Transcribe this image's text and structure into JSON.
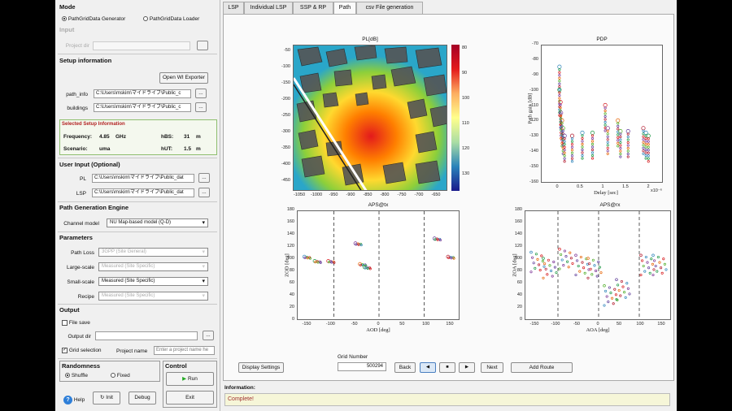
{
  "left": {
    "mode_title": "Mode",
    "mode_opt1": "PathGridData Generator",
    "mode_opt2": "PathGridData Loader",
    "input_title": "Input",
    "project_dir_label": "Project dir",
    "setup_title": "Setup information",
    "open_wi_btn": "Open WI Exporter",
    "path_info_label": "path_info",
    "path_info_value": "C:\\Users\\mskim\\マイドライブ\\Public_c",
    "buildings_label": "buildings",
    "buildings_value": "C:\\Users\\mskim\\マイドライブ\\Public_c",
    "browse": "...",
    "selected_title": "Selected Setup Information",
    "freq_label": "Frequency:",
    "freq_value": "4.85",
    "freq_unit": "GHz",
    "hbs_label": "hBS:",
    "hbs_value": "31",
    "hbs_unit": "m",
    "scenario_label": "Scenario:",
    "scenario_value": "uma",
    "hut_label": "hUT:",
    "hut_value": "1.5",
    "hut_unit": "m",
    "user_input_title": "User Input  (Optional)",
    "pl_label": "PL",
    "pl_value": "C:\\Users\\mskim\\マイドライブ\\Public_dat",
    "lsp_label": "LSP",
    "lsp_value": "C:\\Users\\mskim\\マイドライブ\\Public_dat",
    "pge_title": "Path Generation Engine",
    "channel_model_label": "Channel model",
    "channel_model_value": "NU Map-based model (Q-D)",
    "params_title": "Parameters",
    "path_loss_label": "Path Loss",
    "path_loss_value": "3GPP (Site General)",
    "large_scale_label": "Large-scale",
    "large_scale_value": "Measured (Site Specific)",
    "small_scale_label": "Small-scale",
    "small_scale_value": "Measured (Site Specific)",
    "recipe_label": "Recipe",
    "recipe_value": "Measured (Site Specific)",
    "output_title": "Output",
    "file_save_label": "File save",
    "output_dir_label": "Output dir",
    "grid_selection_label": "Grid selection",
    "project_name_label": "Project name",
    "project_name_placeholder": "Enter a project name he",
    "randomness_title": "Randomness",
    "shuffle_label": "Shuffle",
    "fixed_label": "Fixed",
    "control_title": "Control",
    "run_btn": "Run",
    "help_label": "Help",
    "init_btn": "Init",
    "debug_btn": "Debug",
    "exit_btn": "Exit"
  },
  "tabs": [
    "LSP",
    "Individual LSP",
    "SSP & RP",
    "Path",
    "csv File generation"
  ],
  "active_tab": "Path",
  "plots": {
    "pl": {
      "title": "PL[dB]",
      "xticks": [
        "-1050",
        "-1000",
        "-950",
        "-900",
        "-850",
        "-800",
        "-750",
        "-700",
        "-650"
      ],
      "yticks": [
        "-50",
        "-100",
        "-150",
        "-200",
        "-250",
        "-300",
        "-350",
        "-400",
        "-450"
      ],
      "cbticks": [
        "80",
        "90",
        "100",
        "110",
        "120",
        "130"
      ]
    },
    "pdp": {
      "title": "PDP",
      "xlabel": "Delay [sec]",
      "ylabel": "Path gain [dB]",
      "xticks": [
        "0",
        "0.5",
        "1",
        "1.5",
        "2"
      ],
      "yticks": [
        "-70",
        "-80",
        "-90",
        "-100",
        "-110",
        "-120",
        "-130",
        "-140",
        "-150",
        "-160"
      ],
      "xexp": "x10⁻⁶"
    },
    "aps_tx": {
      "title": "APS@tx",
      "xlabel": "AOD [deg]",
      "ylabel": "ZOD [deg]",
      "xticks": [
        "-150",
        "-100",
        "-50",
        "0",
        "50",
        "100",
        "150"
      ],
      "yticks": [
        "180",
        "160",
        "140",
        "120",
        "100",
        "80",
        "60",
        "40",
        "20",
        "0"
      ]
    },
    "aps_rx": {
      "title": "APS@rx",
      "xlabel": "AOA [deg]",
      "ylabel": "ZOA [deg]",
      "xticks": [
        "-150",
        "-100",
        "-50",
        "0",
        "50",
        "100",
        "150"
      ],
      "yticks": [
        "180",
        "160",
        "140",
        "120",
        "100",
        "80",
        "60",
        "40",
        "20",
        "0"
      ]
    }
  },
  "controls": {
    "display_settings": "Display Settings",
    "grid_number_label": "Grid Number",
    "grid_number_value": "500294",
    "back": "Back",
    "prev_icon": "◀",
    "stop_icon": "■",
    "play_icon": "▶",
    "next": "Next",
    "add_route": "Add Route"
  },
  "info": {
    "label": "Information:",
    "message": "Complete!"
  },
  "colors": {
    "selected_border": "#8fbf6f",
    "selected_title": "#b22222",
    "info_bg": "#f6f6d8",
    "run_icon": "#22a822",
    "help_icon": "#2f7fd8"
  },
  "chart_data": [
    {
      "type": "heatmap",
      "title": "PL[dB]",
      "xlim": [
        -1075,
        -630
      ],
      "ylim": [
        -460,
        -30
      ],
      "colorbar": [
        80,
        135
      ]
    },
    {
      "type": "scatter",
      "title": "PDP",
      "xlabel": "Delay [sec]",
      "ylabel": "Path gain [dB]",
      "xlim": [
        0,
        2.4
      ],
      "ylim": [
        -160,
        -70
      ],
      "x_scale": "x10^-6",
      "series": [
        {
          "x": [
            0.35,
            0.35,
            0.37,
            0.38,
            0.4,
            0.42,
            0.45,
            0.6,
            0.8,
            1.0,
            1.25,
            1.3,
            1.5,
            1.55,
            1.7,
            2.0,
            2.05,
            2.1
          ],
          "y": [
            -95,
            -110,
            -118,
            -125,
            -130,
            -135,
            -140,
            -140,
            -138,
            -138,
            -120,
            -135,
            -130,
            -137,
            -137,
            -135,
            -138,
            -140
          ]
        }
      ]
    },
    {
      "type": "scatter",
      "title": "APS@tx",
      "xlabel": "AOD [deg]",
      "ylabel": "ZOD [deg]",
      "xlim": [
        -180,
        180
      ],
      "ylim": [
        0,
        180
      ],
      "series": [
        {
          "x": [
            -158,
            -135,
            -105,
            -45,
            -35,
            -25,
            130,
            160
          ],
          "y": [
            102,
            95,
            95,
            124,
            90,
            85,
            132,
            102
          ]
        }
      ]
    },
    {
      "type": "scatter",
      "title": "APS@rx",
      "xlabel": "AOA [deg]",
      "ylabel": "ZOA [deg]",
      "xlim": [
        -180,
        180
      ],
      "ylim": [
        0,
        180
      ],
      "series": [
        {
          "x": [
            -150,
            -120,
            -80,
            -40,
            -10,
            30,
            60,
            120,
            150
          ],
          "y": [
            95,
            85,
            100,
            90,
            85,
            40,
            50,
            90,
            90
          ]
        }
      ]
    }
  ]
}
